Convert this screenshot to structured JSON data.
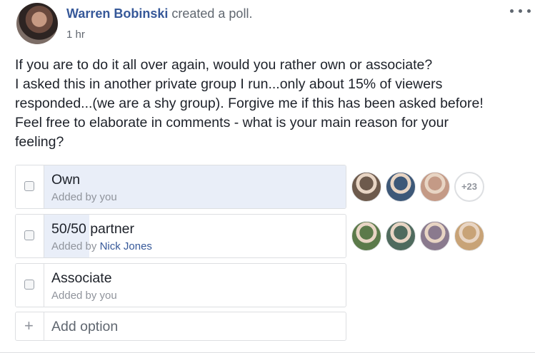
{
  "post": {
    "author": "Warren Bobinski",
    "action": "created a poll.",
    "time": "1 hr",
    "text_lines": [
      "If you are to do it all over again, would you rather own or associate?",
      "I asked this in another private group I run...only about 15% of viewers",
      "responded...(we are a shy group). Forgive me if this has been asked before!",
      "Feel free to elaborate in comments - what is your main reason for your",
      "feeling?"
    ]
  },
  "poll": {
    "options": [
      {
        "label": "Own",
        "added_prefix": "Added by you",
        "added_by": "",
        "vote_share": 1.0,
        "voter_colors": [
          "#6d5a4c",
          "#3d5878",
          "#c49a86"
        ],
        "more_voters": "+23"
      },
      {
        "label": "50/50 partner",
        "added_prefix": "Added by",
        "added_by": "Nick Jones",
        "vote_share": 0.15,
        "voter_colors": [
          "#5b7a4a",
          "#4f6b5e",
          "#8a7a8e",
          "#c8a377"
        ],
        "more_voters": ""
      },
      {
        "label": "Associate",
        "added_prefix": "Added by you",
        "added_by": "",
        "vote_share": 0,
        "voter_colors": [],
        "more_voters": ""
      }
    ],
    "add_option_placeholder": "Add option"
  },
  "colors": {
    "link": "#365899",
    "poll_fill": "#e9eef8",
    "border": "#dddfe2"
  }
}
